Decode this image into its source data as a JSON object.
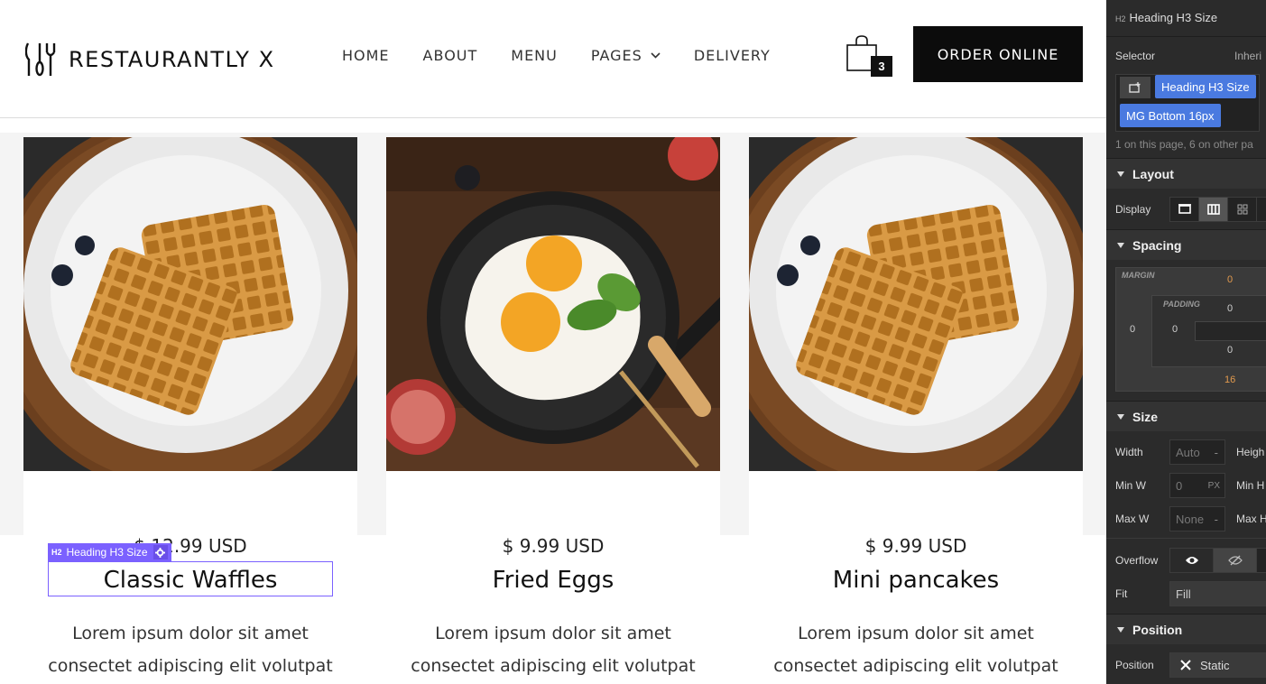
{
  "header": {
    "logo_text": "RESTAURANTLY X",
    "nav": [
      "HOME",
      "ABOUT",
      "MENU",
      "PAGES",
      "DELIVERY"
    ],
    "cart_count": "3",
    "order_button": "ORDER ONLINE"
  },
  "cards": [
    {
      "price": "$ 12.99 USD",
      "title": "Classic Waffles",
      "desc1": "Lorem ipsum dolor sit amet",
      "desc2": "consectet adipiscing elit volutpat"
    },
    {
      "price": "$ 9.99 USD",
      "title": "Fried Eggs",
      "desc1": "Lorem ipsum dolor sit amet",
      "desc2": "consectet adipiscing elit volutpat"
    },
    {
      "price": "$ 9.99 USD",
      "title": "Mini pancakes",
      "desc1": "Lorem ipsum dolor sit amet",
      "desc2": "consectet adipiscing elit volutpat"
    }
  ],
  "selection": {
    "tag_prefix": "H2",
    "tag_label": "Heading H3 Size"
  },
  "panel": {
    "element_prefix": "H2",
    "element_name": "Heading H3 Size",
    "selector_label": "Selector",
    "selector_inherit": "Inheri",
    "class_1": "Heading H3 Size",
    "class_2": "MG Bottom 16px",
    "usage_note": "1 on this page, 6 on other pa",
    "layout_title": "Layout",
    "display_label": "Display",
    "spacing_title": "Spacing",
    "margin_label": "MARGIN",
    "padding_label": "PADDING",
    "margin_top": "0",
    "margin_left": "0",
    "margin_bottom": "16",
    "padding_top": "0",
    "padding_left": "0",
    "padding_bottom": "0",
    "size_title": "Size",
    "width_label": "Width",
    "width_value": "Auto",
    "width_unit": "-",
    "height_label": "Heigh",
    "minw_label": "Min W",
    "minw_value": "0",
    "minw_unit": "PX",
    "minh_label": "Min H",
    "maxw_label": "Max W",
    "maxw_value": "None",
    "maxw_unit": "-",
    "maxh_label": "Max H",
    "overflow_label": "Overflow",
    "fit_label": "Fit",
    "fit_value": "Fill",
    "position_title": "Position",
    "position_label": "Position",
    "position_value": "Static"
  }
}
